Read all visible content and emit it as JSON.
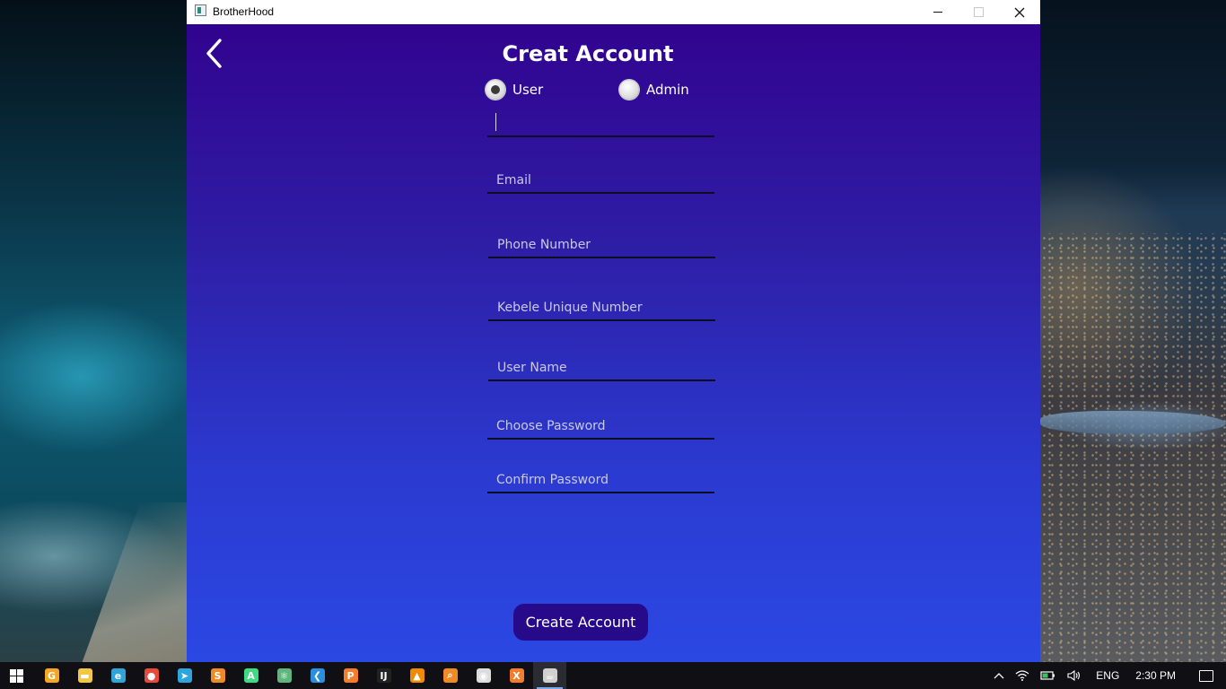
{
  "window": {
    "title": "BrotherHood"
  },
  "form": {
    "heading": "Creat Account",
    "account_type": {
      "options": [
        {
          "label": "User",
          "selected": true
        },
        {
          "label": "Admin",
          "selected": false
        }
      ]
    },
    "fields": [
      {
        "name": "full-name-field",
        "value": "",
        "placeholder": "",
        "focused": true
      },
      {
        "name": "email-field",
        "value": "",
        "placeholder": "Email"
      },
      {
        "name": "phone-number-field",
        "value": "",
        "placeholder": "Phone Number"
      },
      {
        "name": "kebele-unique-number-field",
        "value": "",
        "placeholder": "Kebele Unique Number"
      },
      {
        "name": "user-name-field",
        "value": "",
        "placeholder": "User Name"
      },
      {
        "name": "choose-password-field",
        "value": "",
        "placeholder": "Choose Password"
      },
      {
        "name": "confirm-password-field",
        "value": "",
        "placeholder": "Confirm Password"
      }
    ],
    "submit_label": "Create Account"
  },
  "colors": {
    "background_top": "#31038f",
    "background_bottom": "#2b48e3",
    "button": "#260a8a"
  },
  "taskbar": {
    "apps": [
      {
        "icon": "chrome-canary-icon",
        "color": "#f5a623"
      },
      {
        "icon": "file-explorer-icon",
        "color": "#f2c744"
      },
      {
        "icon": "edge-icon",
        "color": "#2fa4d8"
      },
      {
        "icon": "chrome-icon",
        "color": "#e64a3b"
      },
      {
        "icon": "telegram-icon",
        "color": "#2ea6dd"
      },
      {
        "icon": "sublime-icon",
        "color": "#f08a24"
      },
      {
        "icon": "android-studio-icon",
        "color": "#3ddc84"
      },
      {
        "icon": "atom-icon",
        "color": "#5fb57d"
      },
      {
        "icon": "vscode-icon",
        "color": "#2b8fe0"
      },
      {
        "icon": "postman-icon",
        "color": "#f57c2a"
      },
      {
        "icon": "intellij-icon",
        "color": "#222222"
      },
      {
        "icon": "vlc-icon",
        "color": "#f08a00"
      },
      {
        "icon": "search-app-icon",
        "color": "#f08a24"
      },
      {
        "icon": "obs-icon",
        "color": "#dcdcdc"
      },
      {
        "icon": "xampp-icon",
        "color": "#f57c2a"
      },
      {
        "icon": "java-app-icon",
        "color": "#d0d0d0",
        "active": true
      }
    ],
    "tray": {
      "language": "ENG",
      "time": "2:30 PM"
    }
  }
}
